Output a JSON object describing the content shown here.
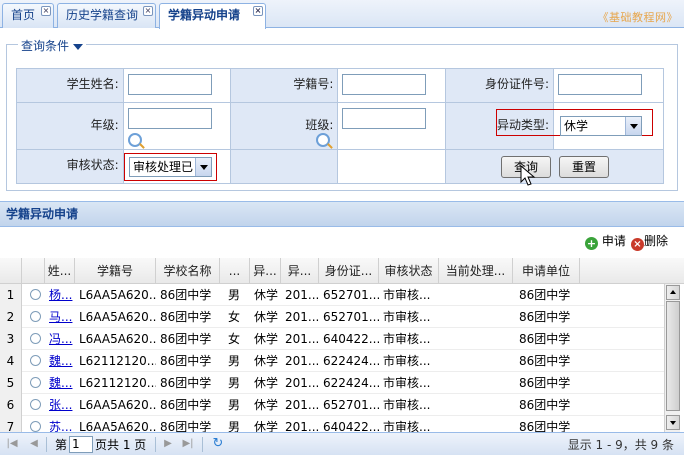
{
  "tabs": [
    {
      "label": "首页",
      "active": false
    },
    {
      "label": "历史学籍查询",
      "active": false
    },
    {
      "label": "学籍异动申请",
      "active": true
    }
  ],
  "brand_text": "《基础教程网》",
  "query": {
    "legend": "查询条件",
    "student_name_label": "学生姓名:",
    "student_name_value": "",
    "student_no_label": "学籍号:",
    "student_no_value": "",
    "id_card_label": "身份证件号:",
    "id_card_value": "",
    "grade_label": "年级:",
    "grade_value": "",
    "class_label": "班级:",
    "class_value": "",
    "change_type_label": "异动类型:",
    "change_type_value": "休学",
    "review_status_label": "审核状态:",
    "review_status_value": "审核处理已",
    "search_button": "查询",
    "reset_button": "重置"
  },
  "grid": {
    "title": "学籍异动申请",
    "apply_button": "申请",
    "delete_button": "删除",
    "columns": [
      "姓...",
      "学籍号",
      "学校名称",
      "...",
      "异...",
      "异...",
      "身份证...",
      "审核状态",
      "当前处理...",
      "申请单位"
    ],
    "rows": [
      {
        "num": "1",
        "name": "杨...",
        "no": "L6AA5A620...",
        "school": "86团中学",
        "gender": "男",
        "type": "休学",
        "date": "201...",
        "id": "652701...",
        "status": "市审核...",
        "current": "",
        "unit": "86团中学"
      },
      {
        "num": "2",
        "name": "马...",
        "no": "L6AA5A620...",
        "school": "86团中学",
        "gender": "女",
        "type": "休学",
        "date": "201...",
        "id": "652701...",
        "status": "市审核...",
        "current": "",
        "unit": "86团中学"
      },
      {
        "num": "3",
        "name": "冯...",
        "no": "L6AA5A620...",
        "school": "86团中学",
        "gender": "女",
        "type": "休学",
        "date": "201...",
        "id": "640422...",
        "status": "市审核...",
        "current": "",
        "unit": "86团中学"
      },
      {
        "num": "4",
        "name": "魏...",
        "no": "L62112120...",
        "school": "86团中学",
        "gender": "男",
        "type": "休学",
        "date": "201...",
        "id": "622424...",
        "status": "市审核...",
        "current": "",
        "unit": "86团中学"
      },
      {
        "num": "5",
        "name": "魏...",
        "no": "L62112120...",
        "school": "86团中学",
        "gender": "男",
        "type": "休学",
        "date": "201...",
        "id": "622424...",
        "status": "市审核...",
        "current": "",
        "unit": "86团中学"
      },
      {
        "num": "6",
        "name": "张...",
        "no": "L6AA5A620...",
        "school": "86团中学",
        "gender": "男",
        "type": "休学",
        "date": "201...",
        "id": "652701...",
        "status": "市审核...",
        "current": "",
        "unit": "86团中学"
      },
      {
        "num": "7",
        "name": "苏...",
        "no": "L6AA5A620...",
        "school": "86团中学",
        "gender": "男",
        "type": "休学",
        "date": "201...",
        "id": "640422...",
        "status": "市审核...",
        "current": "",
        "unit": "86团中学"
      }
    ]
  },
  "pager": {
    "page_prefix": "第",
    "page_value": "1",
    "page_suffix": "页共 1 页",
    "summary": "显示 1 - 9，共 9 条"
  }
}
